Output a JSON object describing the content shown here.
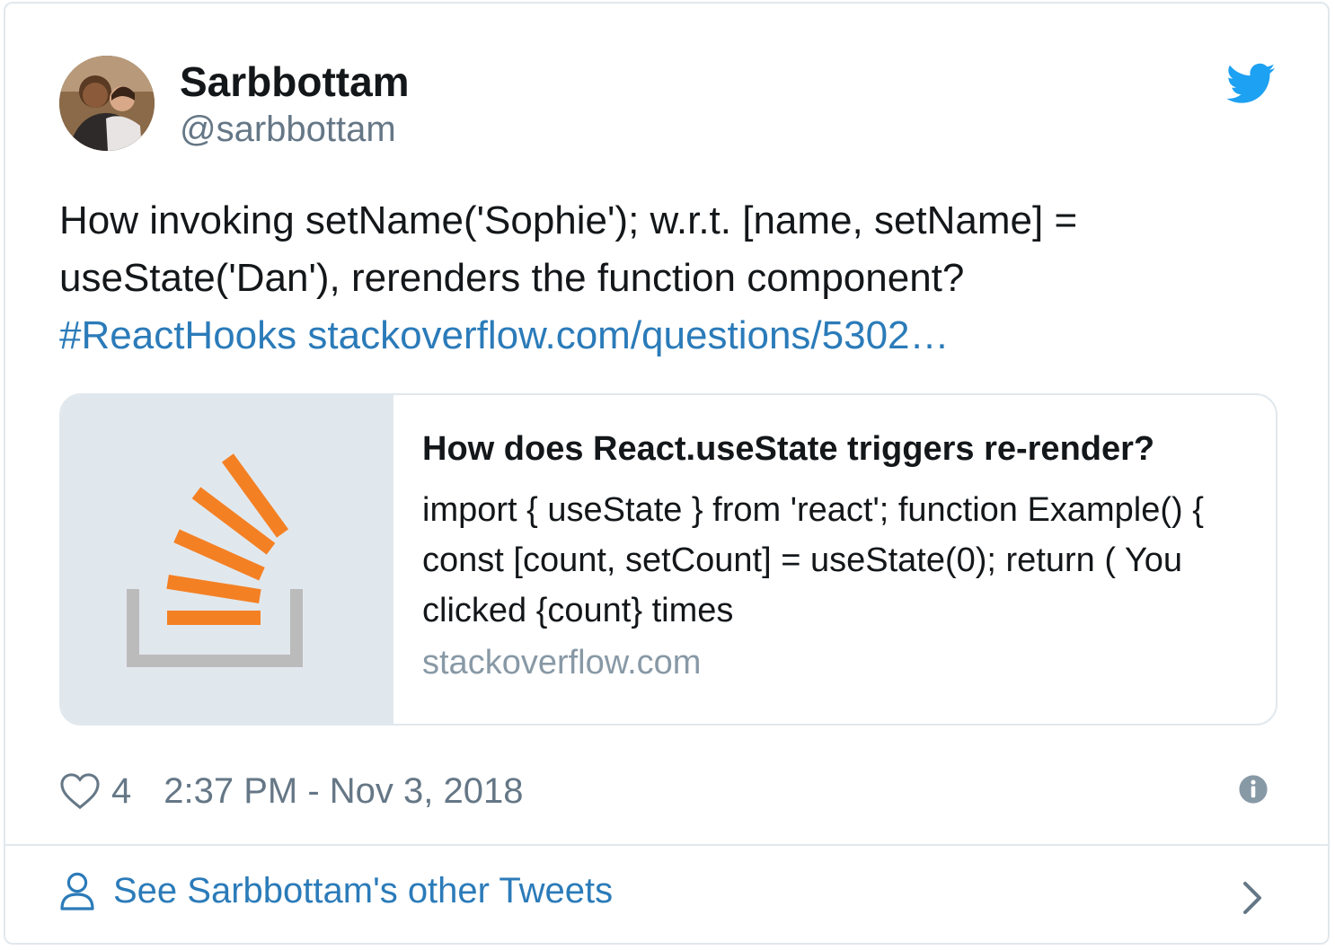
{
  "user": {
    "display_name": "Sarbbottam",
    "handle": "@sarbbottam"
  },
  "tweet": {
    "text_line1": "How invoking setName('Sophie'); w.r.t. [name, setName] =",
    "text_line2": "useState('Dan'), rerenders the function component?",
    "hashtag": "#ReactHooks",
    "url": "stackoverflow.com/questions/5302…"
  },
  "card": {
    "title": "How does React.useState triggers re-render?",
    "description": "import { useState } from 'react'; function Example() { const [count, setCount] = useState(0); return ( You clicked {count} times",
    "domain": "stackoverflow.com"
  },
  "footer": {
    "like_count": "4",
    "timestamp": "2:37 PM - Nov 3, 2018"
  },
  "see_more": {
    "label": "See Sarbbottam's other Tweets"
  },
  "icons": [
    "twitter-bird-icon",
    "heart-icon",
    "info-icon",
    "person-icon",
    "chevron-right-icon",
    "stackoverflow-logo"
  ],
  "colors": {
    "link": "#2b7bb9",
    "bird": "#1da1f2",
    "text": "#14171a",
    "muted": "#657786",
    "so_orange": "#f48024",
    "so_gray": "#bcbbbb"
  }
}
